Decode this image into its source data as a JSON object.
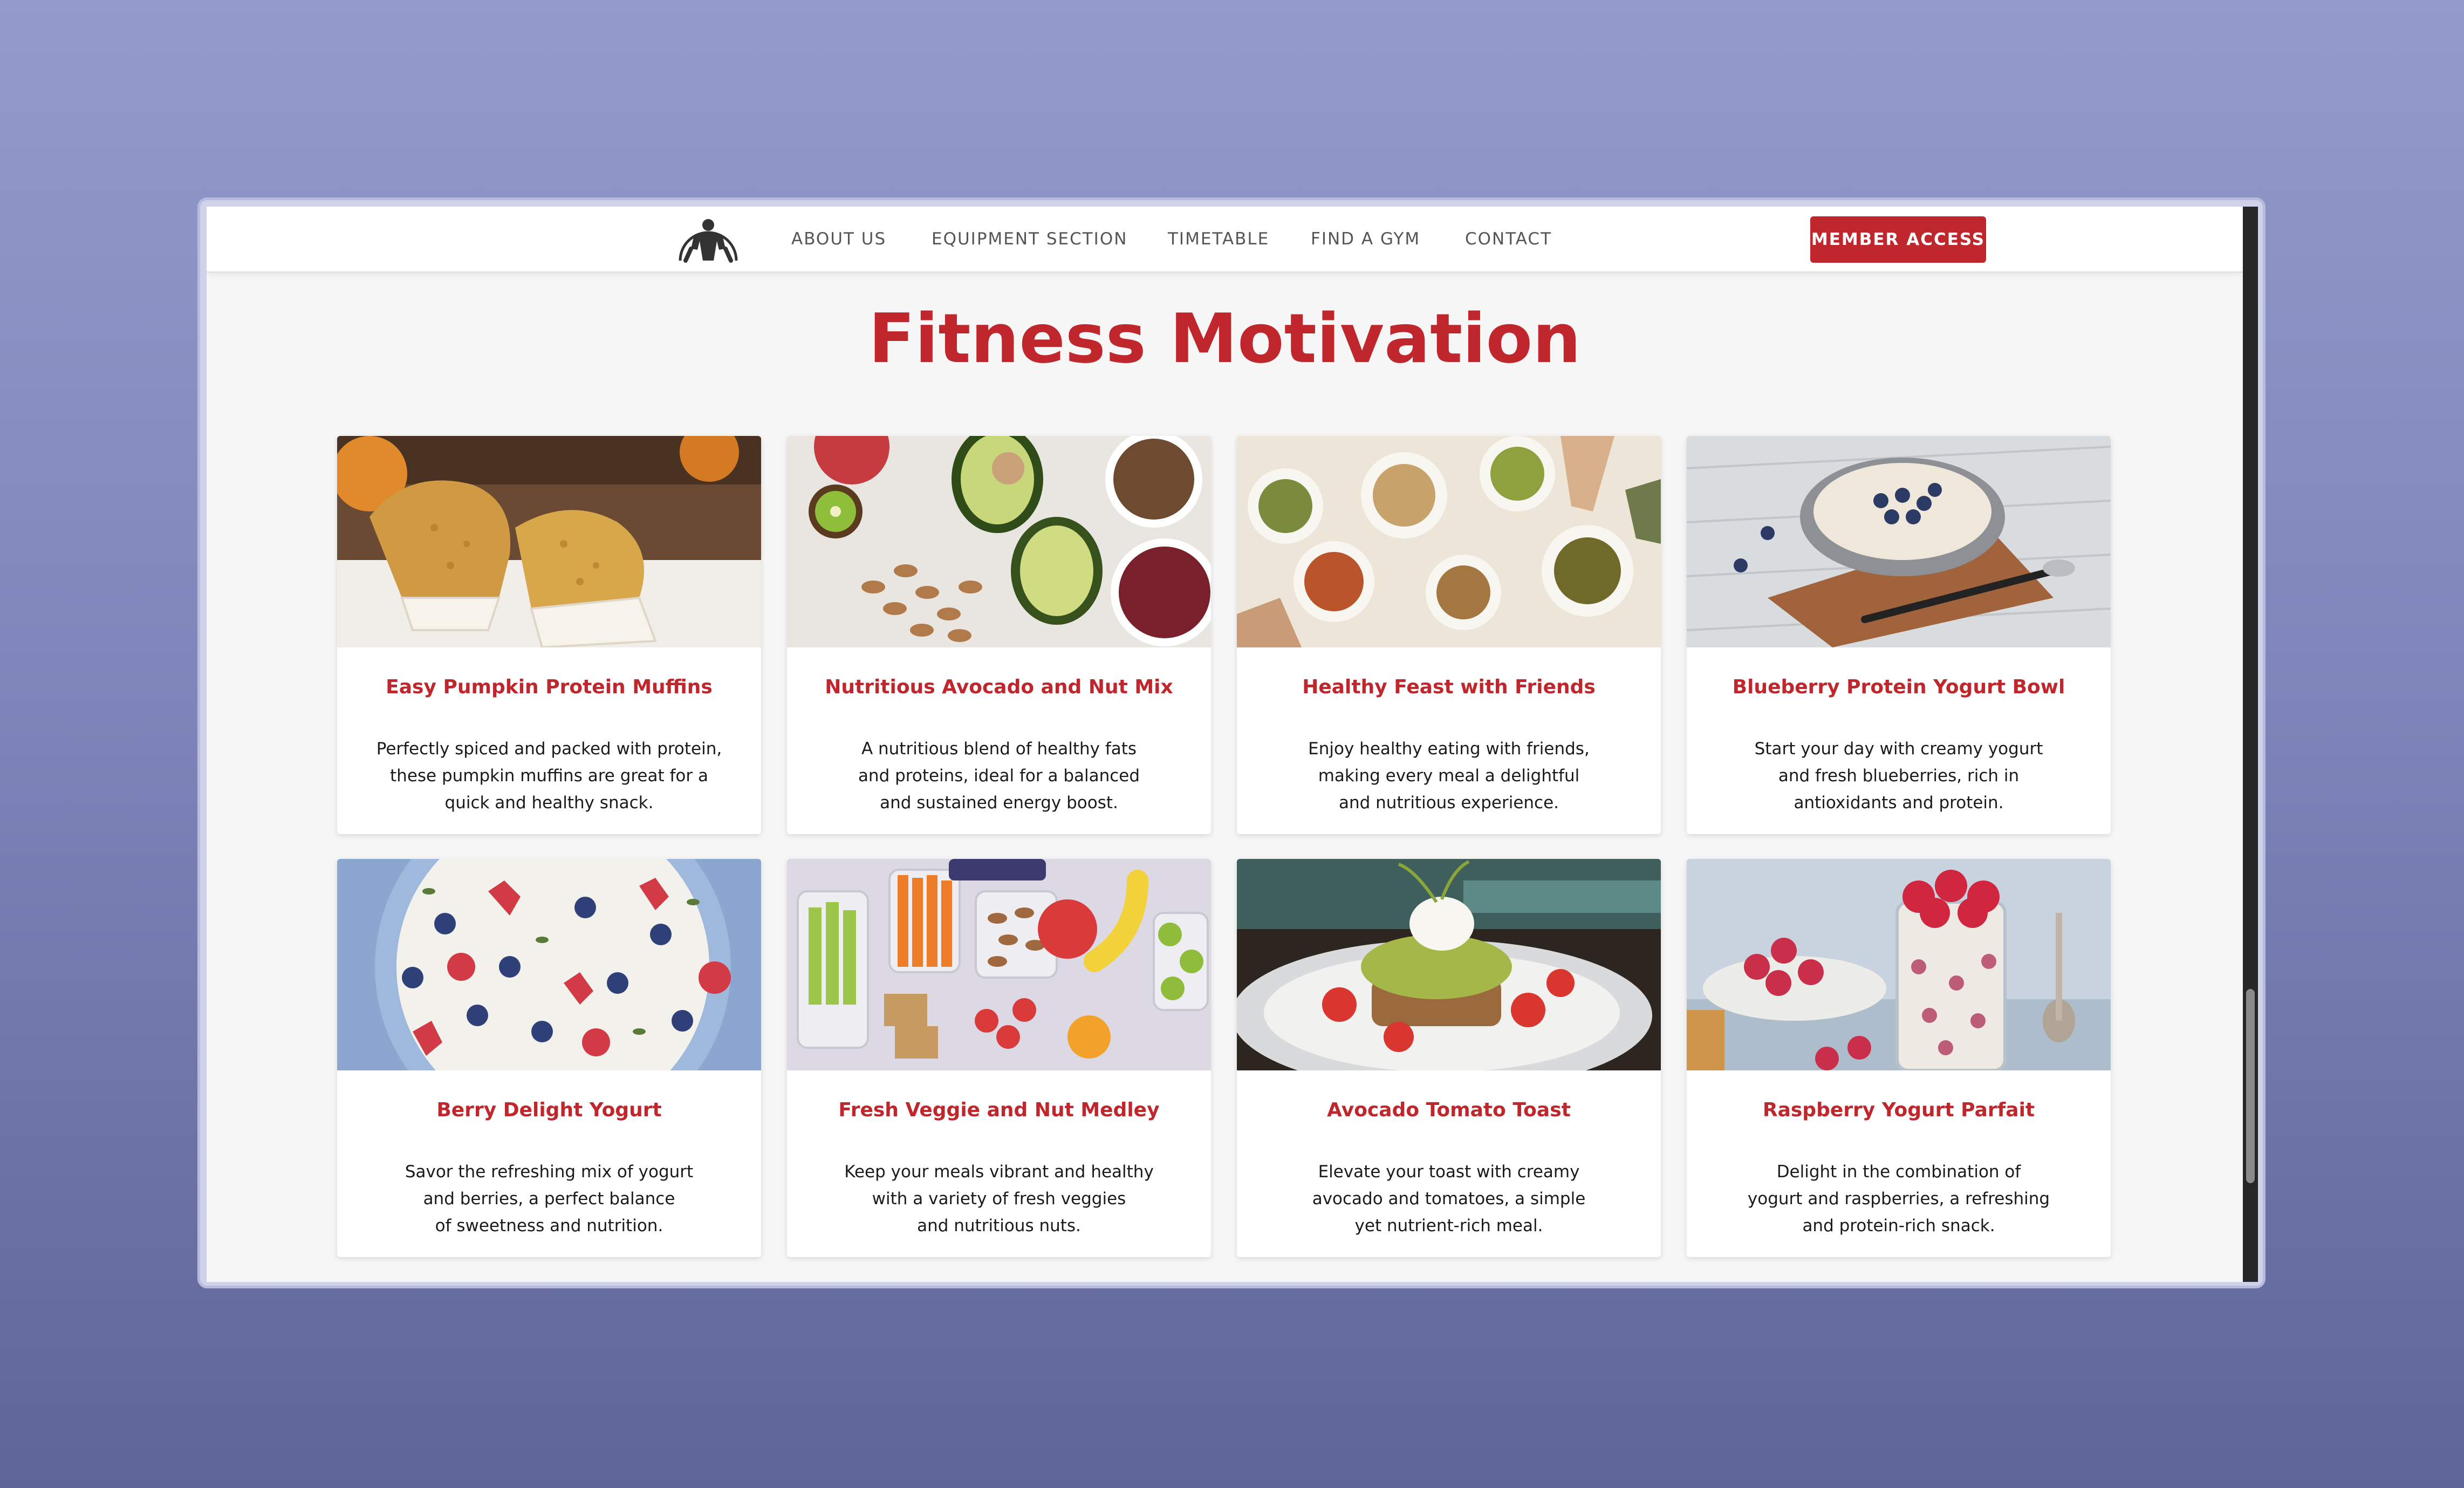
{
  "colors": {
    "brand_red": "#c0272d",
    "nav_text": "#555555",
    "page_bg": "#f6f6f6"
  },
  "navbar": {
    "logo_icon": "muscle-man-logo-icon",
    "items": [
      "ABOUT US",
      "EQUIPMENT SECTION",
      "TIMETABLE",
      "FIND A GYM",
      "CONTACT"
    ],
    "cta_label": "MEMBER ACCESS"
  },
  "main": {
    "title": "Fitness Motivation",
    "cards": [
      {
        "image": "pumpkin-muffins-photo",
        "title": "Easy Pumpkin Protein Muffins",
        "desc_lines": [
          "Perfectly spiced and packed with protein,",
          "these pumpkin muffins are great for a",
          "quick and healthy snack."
        ]
      },
      {
        "image": "avocado-nut-mix-photo",
        "title": "Nutritious Avocado and Nut Mix",
        "desc_lines": [
          "A nutritious blend of healthy fats",
          "and proteins, ideal for a balanced",
          "and sustained energy boost."
        ]
      },
      {
        "image": "feast-with-friends-photo",
        "title": "Healthy Feast with Friends",
        "desc_lines": [
          "Enjoy healthy eating with friends,",
          "making every meal a delightful",
          "and nutritious experience."
        ]
      },
      {
        "image": "blueberry-yogurt-bowl-photo",
        "title": "Blueberry Protein Yogurt Bowl",
        "desc_lines": [
          "Start your day with creamy yogurt",
          "and fresh blueberries, rich in",
          "antioxidants and protein."
        ]
      },
      {
        "image": "berry-yogurt-photo",
        "title": "Berry Delight Yogurt",
        "desc_lines": [
          "Savor the refreshing mix of yogurt",
          "and berries, a perfect balance",
          "of sweetness and nutrition."
        ]
      },
      {
        "image": "veggie-nut-medley-photo",
        "title": "Fresh Veggie and Nut Medley",
        "desc_lines": [
          "Keep your meals vibrant and healthy",
          "with a variety of fresh veggies",
          "and nutritious nuts."
        ]
      },
      {
        "image": "avocado-toast-photo",
        "title": "Avocado Tomato Toast",
        "desc_lines": [
          "Elevate your toast with creamy",
          "avocado and tomatoes, a simple",
          "yet nutrient-rich meal."
        ]
      },
      {
        "image": "raspberry-parfait-photo",
        "title": "Raspberry Yogurt Parfait",
        "desc_lines": [
          "Delight in the combination of",
          "yogurt and raspberries, a refreshing",
          "and protein-rich snack."
        ]
      }
    ]
  }
}
